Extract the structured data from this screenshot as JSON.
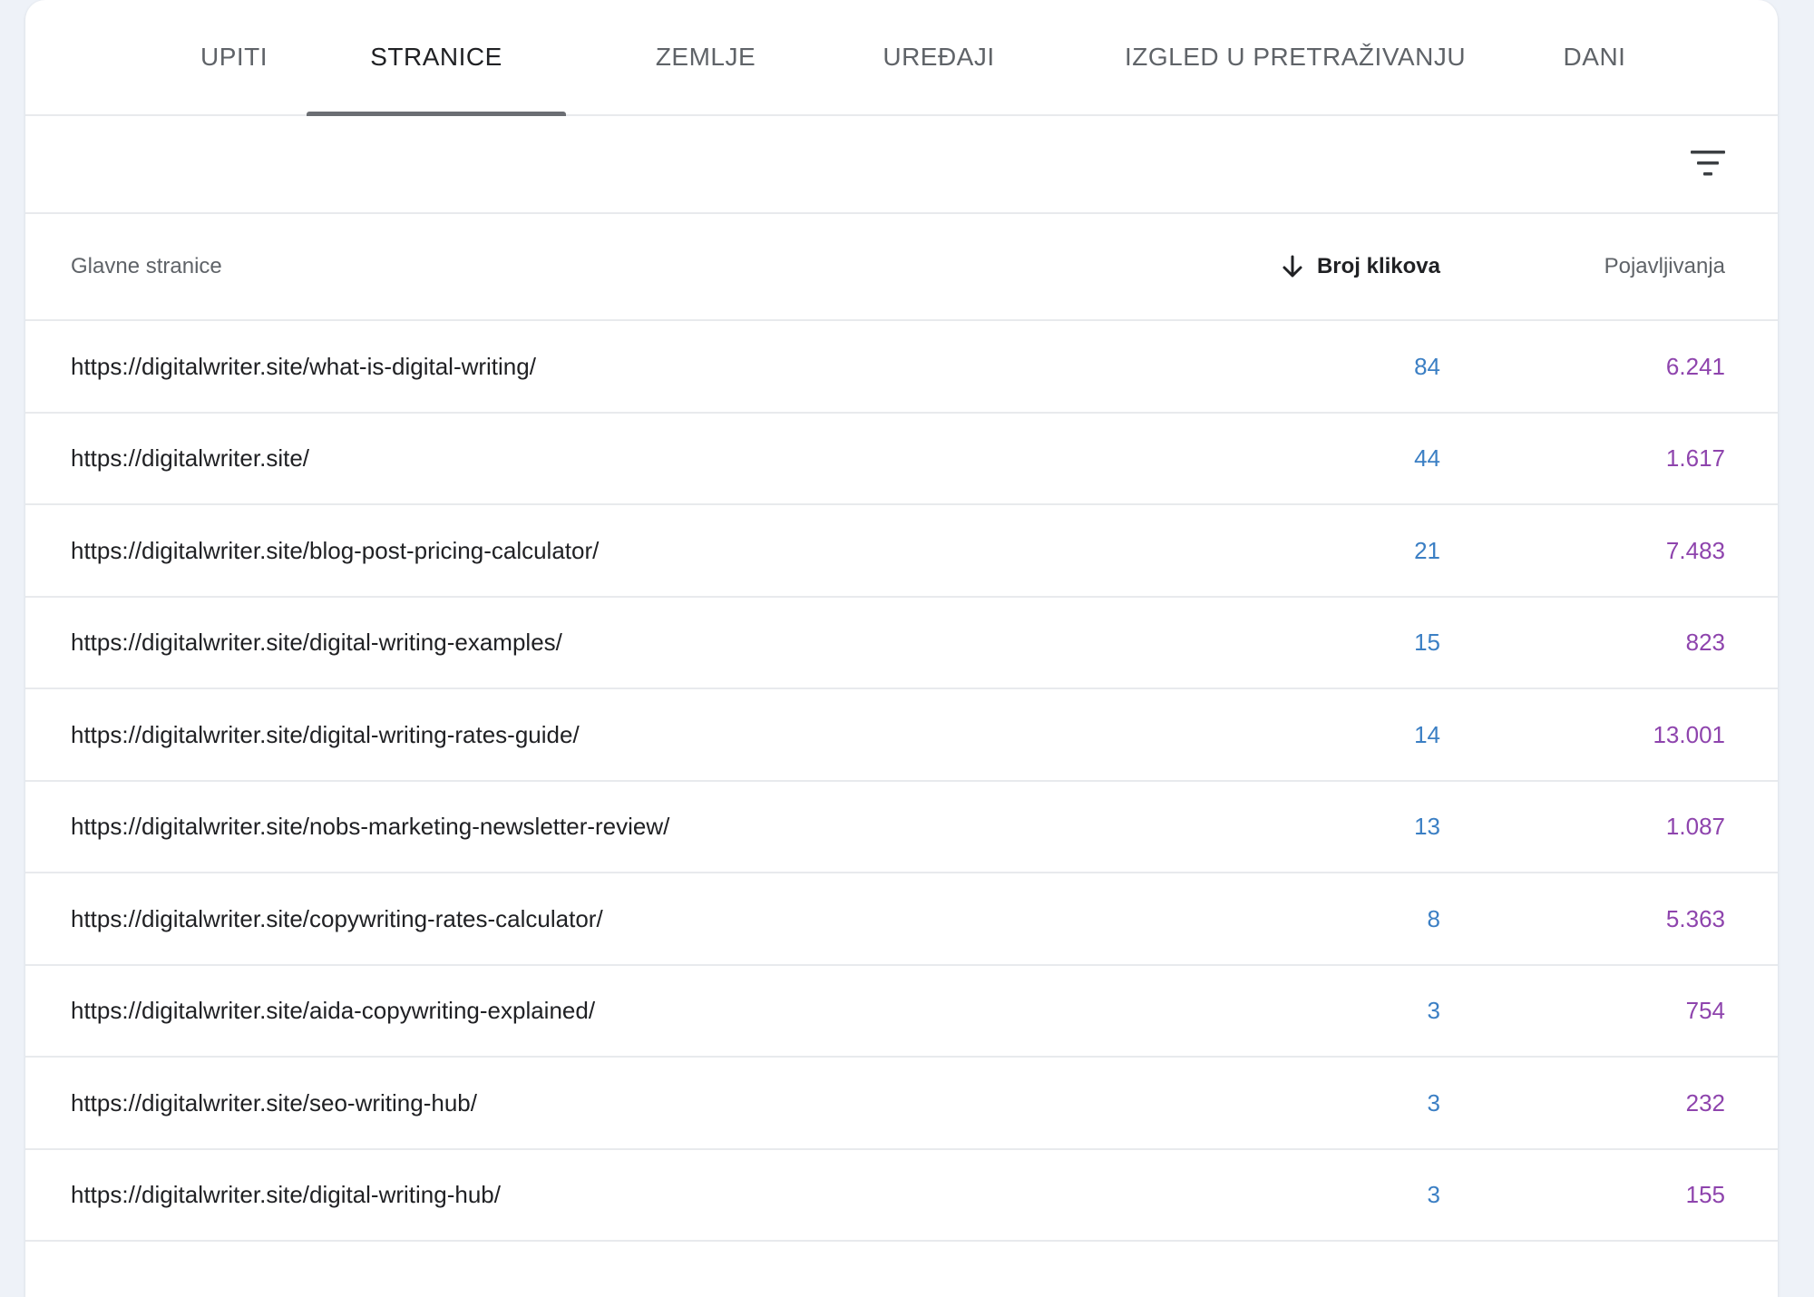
{
  "tabs": [
    {
      "label": "UPITI",
      "active": false
    },
    {
      "label": "STRANICE",
      "active": true
    },
    {
      "label": "ZEMLJE",
      "active": false
    },
    {
      "label": "UREĐAJI",
      "active": false
    },
    {
      "label": "IZGLED U PRETRAŽIVANJU",
      "active": false
    },
    {
      "label": "DANI",
      "active": false
    }
  ],
  "toolbar": {
    "filter_icon": "filter-list-icon"
  },
  "table": {
    "headers": {
      "pages": "Glavne stranice",
      "clicks": "Broj klikova",
      "impressions": "Pojavljivanja"
    },
    "sort": {
      "column": "clicks",
      "direction": "descending",
      "icon": "arrow-down-icon"
    },
    "rows": [
      {
        "url": "https://digitalwriter.site/what-is-digital-writing/",
        "clicks": "84",
        "impressions": "6.241"
      },
      {
        "url": "https://digitalwriter.site/",
        "clicks": "44",
        "impressions": "1.617"
      },
      {
        "url": "https://digitalwriter.site/blog-post-pricing-calculator/",
        "clicks": "21",
        "impressions": "7.483"
      },
      {
        "url": "https://digitalwriter.site/digital-writing-examples/",
        "clicks": "15",
        "impressions": "823"
      },
      {
        "url": "https://digitalwriter.site/digital-writing-rates-guide/",
        "clicks": "14",
        "impressions": "13.001"
      },
      {
        "url": "https://digitalwriter.site/nobs-marketing-newsletter-review/",
        "clicks": "13",
        "impressions": "1.087"
      },
      {
        "url": "https://digitalwriter.site/copywriting-rates-calculator/",
        "clicks": "8",
        "impressions": "5.363"
      },
      {
        "url": "https://digitalwriter.site/aida-copywriting-explained/",
        "clicks": "3",
        "impressions": "754"
      },
      {
        "url": "https://digitalwriter.site/seo-writing-hub/",
        "clicks": "3",
        "impressions": "232"
      },
      {
        "url": "https://digitalwriter.site/digital-writing-hub/",
        "clicks": "3",
        "impressions": "155"
      }
    ]
  },
  "colors": {
    "background": "#eef2f8",
    "card": "#ffffff",
    "clicks": "#3b7fc4",
    "impressions": "#8e44ad",
    "divider": "#e8eaed"
  }
}
